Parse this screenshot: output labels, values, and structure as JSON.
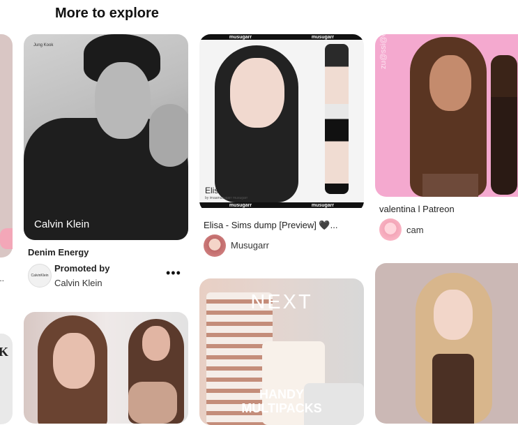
{
  "section": {
    "title": "More to explore"
  },
  "pins": {
    "left_partial": {
      "label": "K",
      "more": "..."
    },
    "calvin": {
      "image_small_text": "Jung Kook",
      "image_brand": "Calvin Klein",
      "caption": "Denim Energy",
      "logo_text": "CalvinKlein",
      "promoted_label": "Promoted by",
      "advertiser": "Calvin Klein",
      "more_icon": "•••"
    },
    "elisa": {
      "watermark_left": "musugarr",
      "watermark_right": "musugarr",
      "image_name": "Elisa",
      "image_by": "by imaamusugarr musugarr",
      "caption": "Elisa - Sims dump [Preview] 🖤...",
      "author": "Musugarr"
    },
    "next": {
      "logo": "NEXT",
      "tagline_line1": "HANDY",
      "tagline_line2": "MULTIPACKS"
    },
    "valentina": {
      "image_text": "zu@ssi@e",
      "caption": "valentina l Patreon",
      "author": "cam"
    }
  }
}
